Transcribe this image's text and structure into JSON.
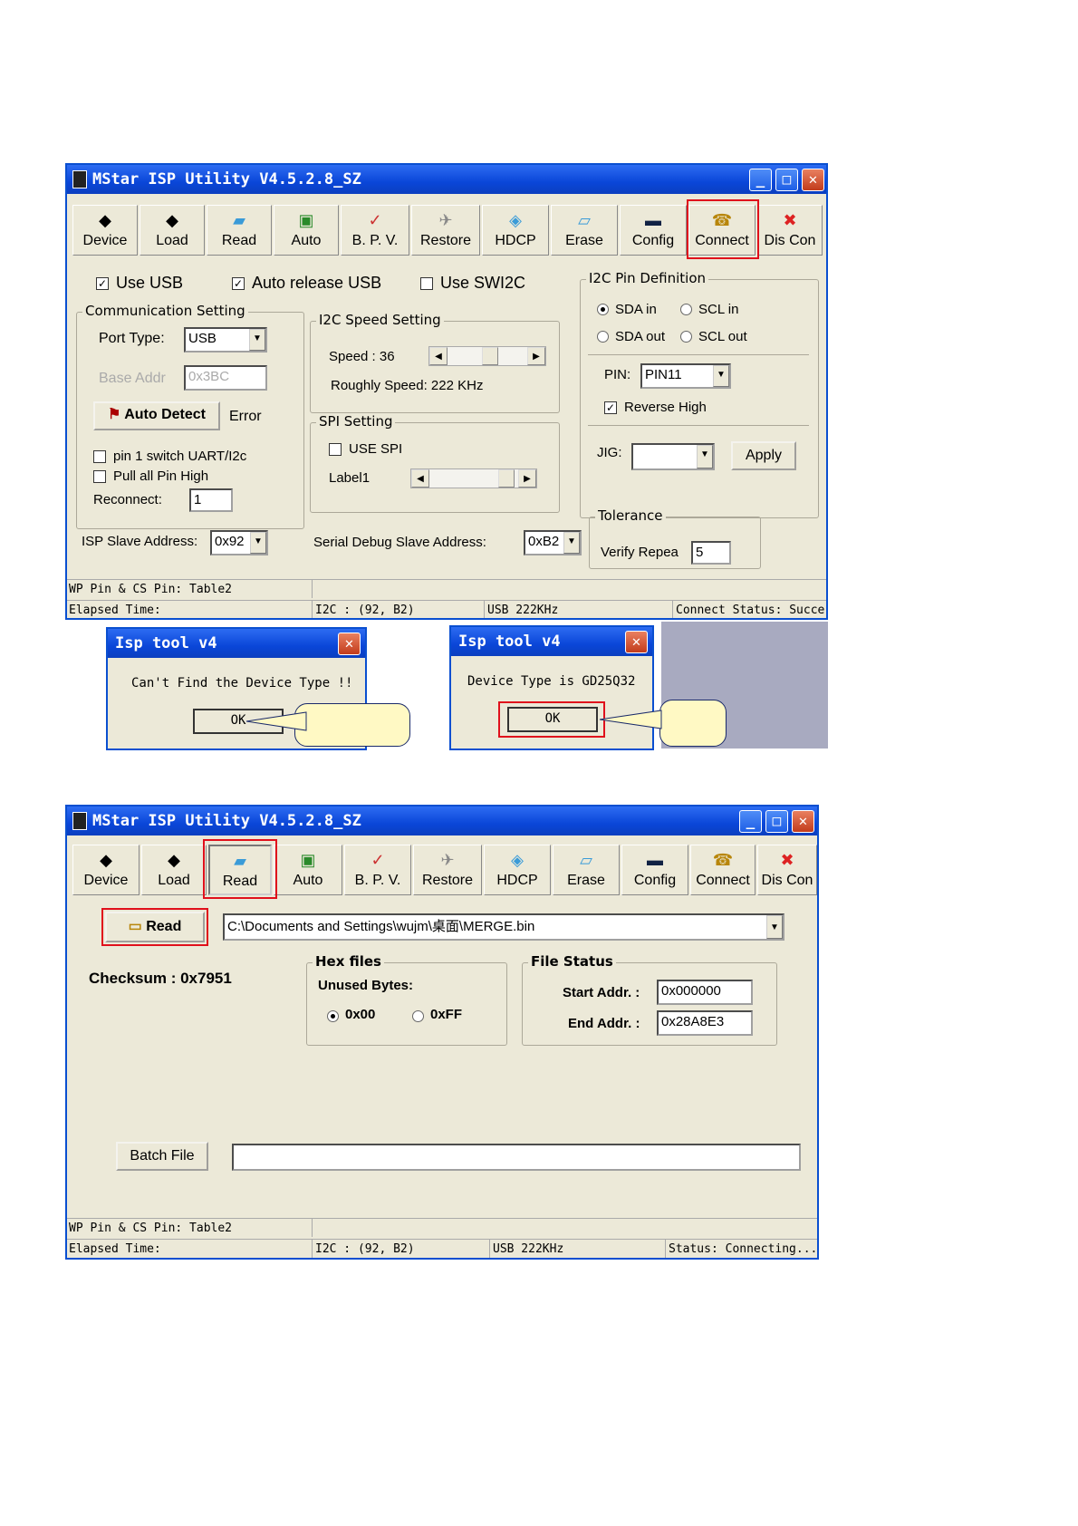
{
  "win1": {
    "title": "MStar ISP Utility V4.5.2.8_SZ",
    "tools": [
      {
        "label": "Device",
        "icon": "device-icon"
      },
      {
        "label": "Load",
        "icon": "load-icon"
      },
      {
        "label": "Read",
        "icon": "read-icon"
      },
      {
        "label": "Auto",
        "icon": "auto-icon"
      },
      {
        "label": "B. P. V.",
        "icon": "bpv-icon"
      },
      {
        "label": "Restore",
        "icon": "restore-icon"
      },
      {
        "label": "HDCP",
        "icon": "hdcp-icon"
      },
      {
        "label": "Erase",
        "icon": "erase-icon"
      },
      {
        "label": "Config",
        "icon": "config-icon"
      },
      {
        "label": "Connect",
        "icon": "connect-icon"
      },
      {
        "label": "Dis Con",
        "icon": "disconnect-icon"
      }
    ],
    "use_usb": "Use USB",
    "auto_release_usb": "Auto release USB",
    "use_swi2c": "Use SWI2C",
    "comm": {
      "caption": "Communication Setting",
      "port_type_label": "Port Type:",
      "port_type_value": "USB",
      "base_addr_label": "Base Addr",
      "base_addr_value": "0x3BC",
      "auto_detect": "Auto Detect",
      "error": "Error",
      "pin1_switch": "pin 1 switch UART/I2c",
      "pull_all": "Pull all Pin High",
      "reconnect_label": "Reconnect:",
      "reconnect_value": "1"
    },
    "i2c_speed": {
      "caption": "I2C Speed Setting",
      "speed_label": "Speed : 36",
      "rough": "Roughly Speed: 222 KHz"
    },
    "spi": {
      "caption": "SPI Setting",
      "use_spi": "USE SPI",
      "label1": "Label1"
    },
    "isp_slave_label": "ISP Slave Address:",
    "isp_slave_value": "0x92",
    "serial_debug_label": "Serial Debug Slave Address:",
    "serial_debug_value": "0xB2",
    "pin_def": {
      "caption": "I2C Pin Definition",
      "sda_in": "SDA in",
      "scl_in": "SCL in",
      "sda_out": "SDA out",
      "scl_out": "SCL out",
      "pin_label": "PIN:",
      "pin_value": "PIN11",
      "reverse_high": "Reverse High",
      "jig_label": "JIG:",
      "apply": "Apply"
    },
    "tolerance": {
      "caption": "Tolerance",
      "verify_label": "Verify Repea",
      "verify_value": "5"
    },
    "status": {
      "wp": "WP Pin & CS Pin: Table2",
      "elapsed": "Elapsed Time:",
      "i2c": "I2C : (92, B2)",
      "usb": "USB 222KHz",
      "connect": "Connect Status: Succe"
    }
  },
  "dialog1": {
    "title": "Isp tool v4",
    "message": "Can't Find the Device Type !!",
    "ok": "OK"
  },
  "dialog2": {
    "title": "Isp tool v4",
    "message": "Device Type is GD25Q32",
    "ok": "OK"
  },
  "win2": {
    "title": "MStar ISP Utility V4.5.2.8_SZ",
    "tools": [
      {
        "label": "Device",
        "icon": "device-icon"
      },
      {
        "label": "Load",
        "icon": "load-icon"
      },
      {
        "label": "Read",
        "icon": "read-icon"
      },
      {
        "label": "Auto",
        "icon": "auto-icon"
      },
      {
        "label": "B. P. V.",
        "icon": "bpv-icon"
      },
      {
        "label": "Restore",
        "icon": "restore-icon"
      },
      {
        "label": "HDCP",
        "icon": "hdcp-icon"
      },
      {
        "label": "Erase",
        "icon": "erase-icon"
      },
      {
        "label": "Config",
        "icon": "config-icon"
      },
      {
        "label": "Connect",
        "icon": "connect-icon"
      },
      {
        "label": "Dis Con",
        "icon": "disconnect-icon"
      }
    ],
    "read_button": "Read",
    "path": "C:\\Documents and Settings\\wujm\\桌面\\MERGE.bin",
    "checksum": "Checksum : 0x7951",
    "hex": {
      "caption": "Hex files",
      "unused": "Unused Bytes:",
      "opt1": "0x00",
      "opt2": "0xFF"
    },
    "file_status": {
      "caption": "File Status",
      "start_label": "Start Addr. :",
      "start_value": "0x000000",
      "end_label": "End Addr. :",
      "end_value": "0x28A8E3"
    },
    "batch_file": "Batch File",
    "status": {
      "wp": "WP Pin & CS Pin: Table2",
      "elapsed": "Elapsed Time:",
      "i2c": "I2C : (92, B2)",
      "usb": "USB 222KHz",
      "connect": "Status: Connecting..."
    }
  }
}
